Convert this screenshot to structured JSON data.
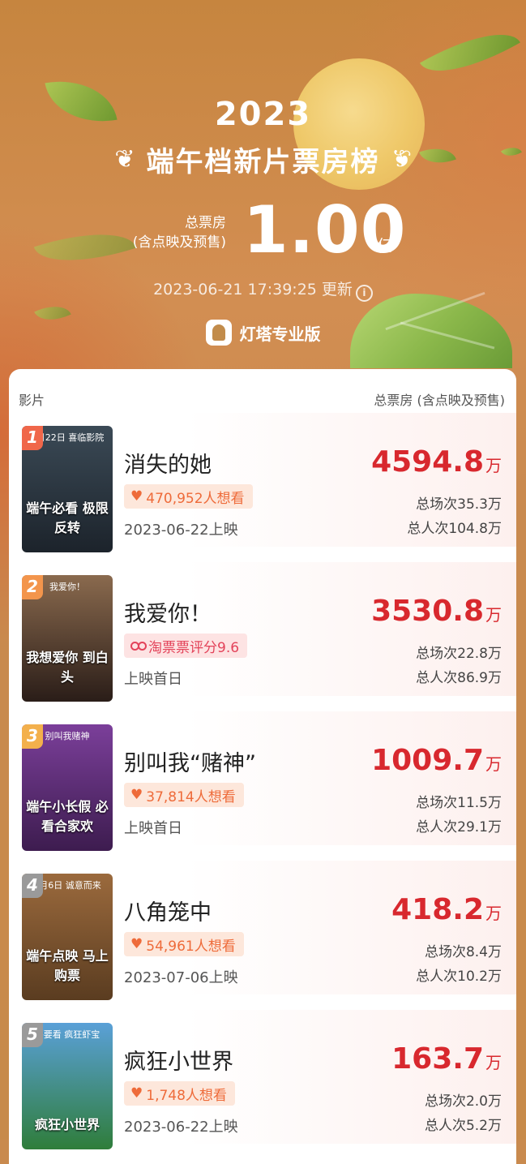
{
  "header": {
    "year": "2023",
    "title": "端午档新片票房榜",
    "total_label_1": "总票房",
    "total_label_2": "(含点映及预售)",
    "total_value": "1.00",
    "total_unit": "亿",
    "updated": "2023-06-21 17:39:25 更新",
    "brand": "灯塔专业版"
  },
  "table": {
    "col_film": "影片",
    "col_box": "总票房 (含点映及预售)"
  },
  "movies": [
    {
      "rank": "1",
      "title": "消失的她",
      "badge": "470,952人想看",
      "badge_type": "want",
      "release": "2023-06-22上映",
      "box": "4594.8",
      "unit": "万",
      "shows": "总场次35.3万",
      "admissions": "总人次104.8万",
      "poster_top": "6月22日 喜临影院",
      "poster_text": "端午必看 极限反转",
      "poster_colors": [
        "#3b4a56",
        "#1c232b"
      ],
      "rank_color": "#f0674a"
    },
    {
      "rank": "2",
      "title": "我爱你！",
      "badge": "淘票票评分9.6",
      "badge_type": "rating",
      "release": "上映首日",
      "box": "3530.8",
      "unit": "万",
      "shows": "总场次22.8万",
      "admissions": "总人次86.9万",
      "poster_top": "我爱你！",
      "poster_text": "我想爱你 到白头",
      "poster_colors": [
        "#8a6a4e",
        "#2a1d18"
      ],
      "rank_color": "#f3954c"
    },
    {
      "rank": "3",
      "title": "别叫我“赌神”",
      "badge": "37,814人想看",
      "badge_type": "want",
      "release": "上映首日",
      "box": "1009.7",
      "unit": "万",
      "shows": "总场次11.5万",
      "admissions": "总人次29.1万",
      "poster_top": "别叫我赌神",
      "poster_text": "端午小长假 必看合家欢",
      "poster_colors": [
        "#7b3f9a",
        "#3d1c4f"
      ],
      "rank_color": "#f3b04c"
    },
    {
      "rank": "4",
      "title": "八角笼中",
      "badge": "54,961人想看",
      "badge_type": "want",
      "release": "2023-07-06上映",
      "box": "418.2",
      "unit": "万",
      "shows": "总场次8.4万",
      "admissions": "总人次10.2万",
      "poster_top": "7月6日 诚意而来",
      "poster_text": "端午点映 马上购票",
      "poster_colors": [
        "#9b6a3d",
        "#5a3c20"
      ],
      "rank_color": "#9a9a9a"
    },
    {
      "rank": "5",
      "title": "疯狂小世界",
      "badge": "1,748人想看",
      "badge_type": "want",
      "release": "2023-06-22上映",
      "box": "163.7",
      "unit": "万",
      "shows": "总场次2.0万",
      "admissions": "总人次5.2万",
      "poster_top": "午要看 疯狂虾宝",
      "poster_text": "疯狂小世界",
      "poster_colors": [
        "#5aa0d8",
        "#2f7d3a"
      ],
      "rank_color": "#9a9a9a"
    }
  ]
}
